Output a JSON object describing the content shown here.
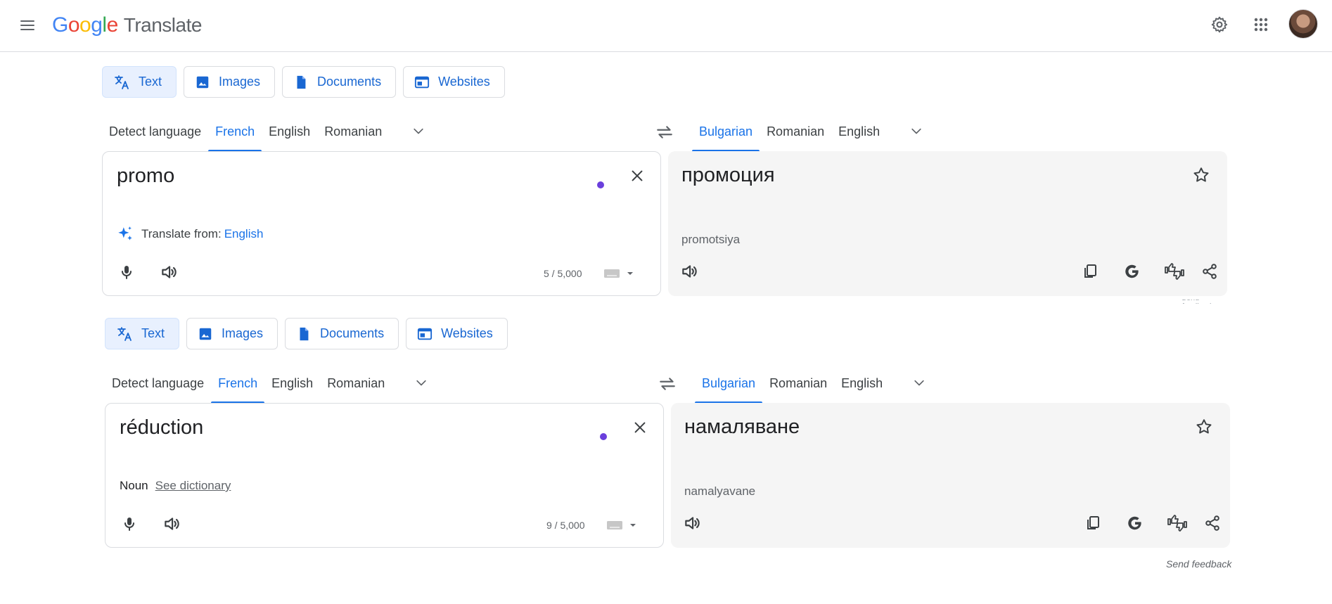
{
  "app": {
    "logo": [
      "G",
      "o",
      "o",
      "g",
      "l",
      "e"
    ],
    "product": "Translate"
  },
  "colors": {
    "accent": "#1a73e8",
    "border": "#dadce0",
    "panel_bg": "#f5f5f5",
    "active_mode_bg": "#e8f0fe",
    "dot": "#6a3fdc"
  },
  "header": {
    "icons": [
      "menu-icon",
      "settings-gear-icon",
      "apps-grid-icon",
      "avatar"
    ]
  },
  "blocks": [
    {
      "modes": [
        "Text",
        "Images",
        "Documents",
        "Websites"
      ],
      "active_mode": "Text",
      "source_langs": [
        "Detect language",
        "French",
        "English",
        "Romanian"
      ],
      "source_active": "French",
      "target_langs": [
        "Bulgarian",
        "Romanian",
        "English"
      ],
      "target_active": "Bulgarian",
      "source_text": "promo",
      "suggest_label": "Translate from:",
      "suggest_lang": "English",
      "counter": "5 / 5,000",
      "translation": "промоция",
      "transliteration": "promotsiya"
    },
    {
      "modes": [
        "Text",
        "Images",
        "Documents",
        "Websites"
      ],
      "active_mode": "Text",
      "source_langs": [
        "Detect language",
        "French",
        "English",
        "Romanian"
      ],
      "source_active": "French",
      "target_langs": [
        "Bulgarian",
        "Romanian",
        "English"
      ],
      "target_active": "Bulgarian",
      "source_text": "réduction",
      "part_of_speech": "Noun",
      "see_dictionary": "See dictionary",
      "counter": "9 / 5,000",
      "translation": "намаляване",
      "transliteration": "namalyavane"
    }
  ],
  "footer": {
    "send_feedback": "Send feedback"
  }
}
